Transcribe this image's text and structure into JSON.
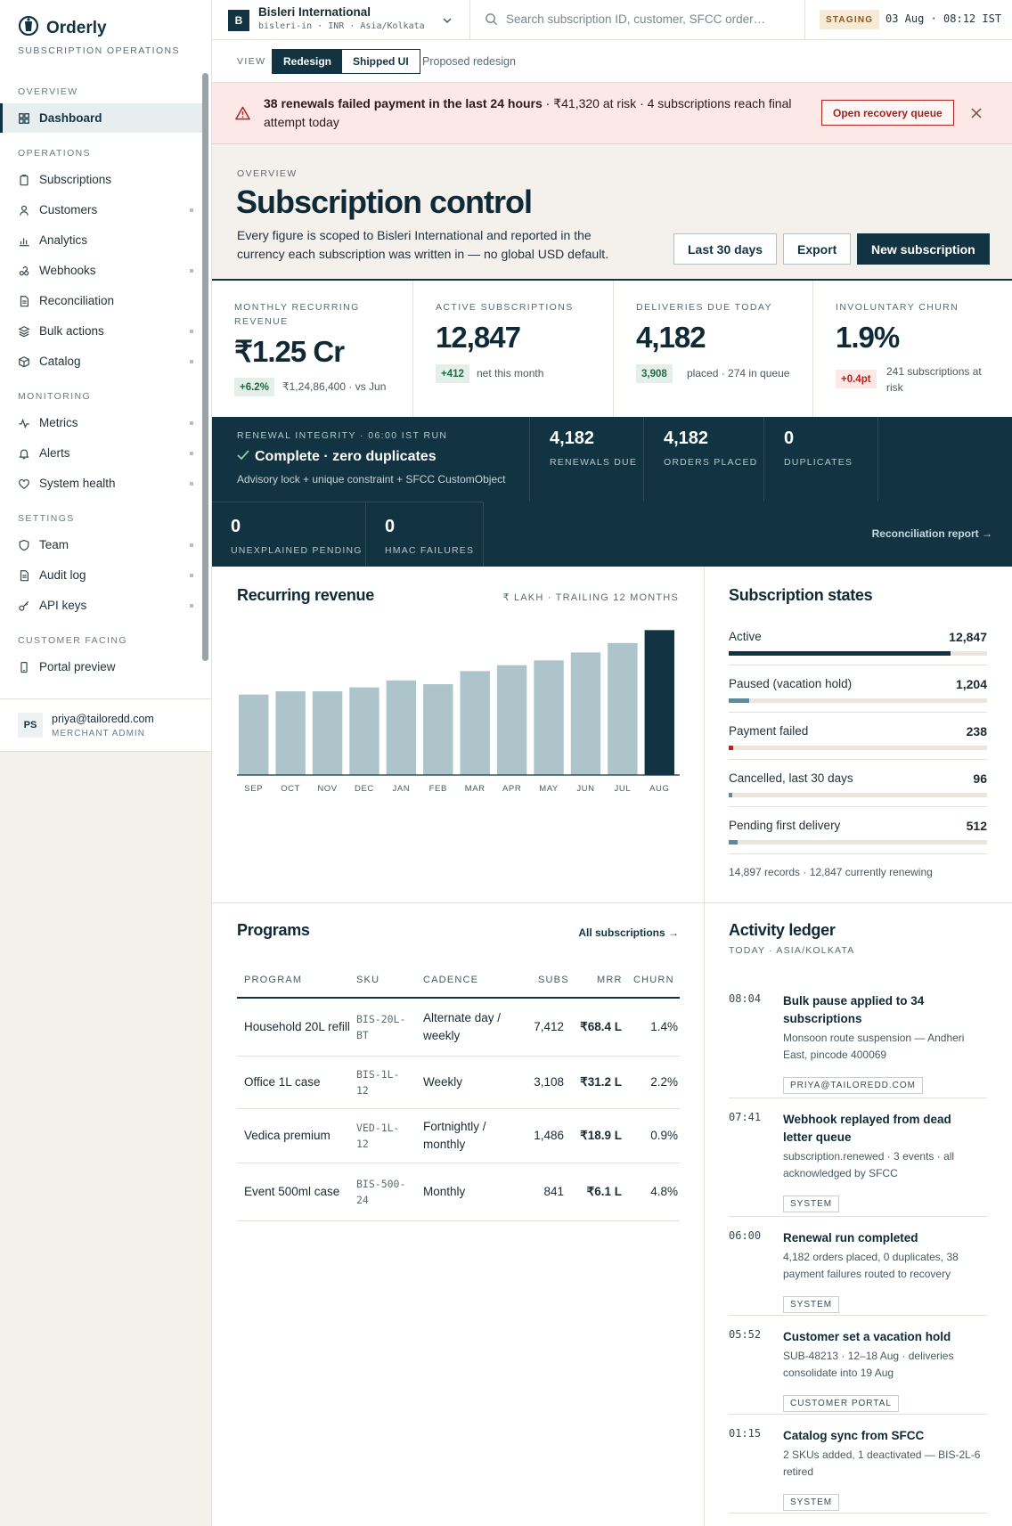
{
  "app": {
    "name": "Orderly",
    "subtitle": "SUBSCRIPTION OPERATIONS"
  },
  "sidebar": {
    "sections": [
      {
        "label": "OVERVIEW",
        "items": [
          {
            "label": "Dashboard",
            "icon": "grid-icon",
            "active": true
          }
        ]
      },
      {
        "label": "OPERATIONS",
        "items": [
          {
            "label": "Subscriptions",
            "icon": "clipboard-icon"
          },
          {
            "label": "Customers",
            "icon": "user-icon",
            "more": true
          },
          {
            "label": "Analytics",
            "icon": "bar-chart-icon"
          },
          {
            "label": "Webhooks",
            "icon": "webhook-icon",
            "more": true
          },
          {
            "label": "Reconciliation",
            "icon": "document-icon"
          },
          {
            "label": "Bulk actions",
            "icon": "layers-icon",
            "more": true
          },
          {
            "label": "Catalog",
            "icon": "box-icon",
            "more": true
          }
        ]
      },
      {
        "label": "MONITORING",
        "items": [
          {
            "label": "Metrics",
            "icon": "pulse-icon",
            "more": true
          },
          {
            "label": "Alerts",
            "icon": "bell-icon",
            "more": true
          },
          {
            "label": "System health",
            "icon": "heart-icon",
            "more": true
          }
        ]
      },
      {
        "label": "SETTINGS",
        "items": [
          {
            "label": "Team",
            "icon": "shield-icon",
            "more": true
          },
          {
            "label": "Audit log",
            "icon": "document-icon",
            "more": true
          },
          {
            "label": "API keys",
            "icon": "key-icon",
            "more": true
          }
        ]
      },
      {
        "label": "CUSTOMER FACING",
        "items": [
          {
            "label": "Portal preview",
            "icon": "phone-icon"
          }
        ]
      }
    ],
    "user": {
      "initials": "PS",
      "email": "priya@tailoredd.com",
      "role": "MERCHANT ADMIN"
    }
  },
  "topbar": {
    "org_initial": "B",
    "org_name": "Bisleri International",
    "org_meta": "bisleri-in · INR · Asia/Kolkata",
    "search_placeholder": "Search subscription ID, customer, SFCC order…",
    "env": "STAGING",
    "clock": "03 Aug · 08:12 IST"
  },
  "viewbar": {
    "label": "VIEW",
    "option_on": "Redesign",
    "option_off": "Shipped UI",
    "note": "Proposed redesign"
  },
  "alert": {
    "title": "38 renewals failed payment in the last 24 hours",
    "body": " · ₹41,320 at risk · 4 subscriptions reach final attempt today",
    "action": "Open recovery queue"
  },
  "hero": {
    "eyebrow": "OVERVIEW",
    "title": "Subscription control",
    "description": "Every figure is scoped to Bisleri International and reported in the currency each subscription was written in — no global USD default.",
    "btn_range": "Last 30 days",
    "btn_export": "Export",
    "btn_new": "New subscription"
  },
  "kpis": [
    {
      "label": "MONTHLY RECURRING REVENUE",
      "value": "₹1.25 Cr",
      "delta": "+6.2%",
      "delta_kind": "g",
      "note": "₹1,24,86,400 · vs Jun"
    },
    {
      "label": "ACTIVE SUBSCRIPTIONS",
      "value": "12,847",
      "delta": "+412",
      "delta_kind": "g",
      "note": "net this month"
    },
    {
      "label": "DELIVERIES DUE TODAY",
      "value": "4,182",
      "delta": "3,908",
      "delta_kind": "g",
      "note": "placed · 274 in queue"
    },
    {
      "label": "INVOLUNTARY CHURN",
      "value": "1.9%",
      "delta": "+0.4pt",
      "delta_kind": "r",
      "note": "241 subscriptions at risk"
    }
  ],
  "integrity": {
    "eyebrow": "RENEWAL INTEGRITY · 06:00 IST RUN",
    "title": "Complete · zero duplicates",
    "subtitle": "Advisory lock + unique constraint + SFCC CustomObject",
    "metrics": [
      {
        "value": "4,182",
        "label": "RENEWALS DUE"
      },
      {
        "value": "4,182",
        "label": "ORDERS PLACED"
      },
      {
        "value": "0",
        "label": "DUPLICATES"
      },
      {
        "value": "0",
        "label": "UNEXPLAINED PENDING"
      },
      {
        "value": "0",
        "label": "HMAC FAILURES"
      }
    ],
    "link": "Reconciliation report →"
  },
  "revenue": {
    "title": "Recurring revenue",
    "meta": "₹ LAKH · TRAILING 12 MONTHS"
  },
  "chart_data": {
    "type": "bar",
    "title": "Recurring revenue",
    "subtitle": "₹ LAKH · TRAILING 12 MONTHS",
    "categories": [
      "SEP",
      "OCT",
      "NOV",
      "DEC",
      "JAN",
      "FEB",
      "MAR",
      "APR",
      "MAY",
      "JUN",
      "JUL",
      "AUG"
    ],
    "values": [
      92.7,
      96.4,
      96.4,
      100.9,
      109.0,
      104.6,
      119.7,
      126.5,
      132.0,
      141.2,
      152.0,
      166.9
    ],
    "highlight_index": 11,
    "bar_color": "#adc4ca",
    "highlight_color": "#123442",
    "grid": false
  },
  "states": {
    "title": "Subscription states",
    "rows": [
      {
        "name": "Active",
        "value": "12,847",
        "fraction": 0.86,
        "color": "#123442"
      },
      {
        "name": "Paused (vacation hold)",
        "value": "1,204",
        "fraction": 0.08,
        "color": "#5e8a98"
      },
      {
        "name": "Payment failed",
        "value": "238",
        "fraction": 0.016,
        "color": "#b3261e"
      },
      {
        "name": "Cancelled, last 30 days",
        "value": "96",
        "fraction": 0.006,
        "color": "#5e8a98"
      },
      {
        "name": "Pending first delivery",
        "value": "512",
        "fraction": 0.034,
        "color": "#5e8a98"
      }
    ],
    "footer": "14,897 records · 12,847 currently renewing"
  },
  "programs": {
    "title": "Programs",
    "link": "All subscriptions →",
    "headers": [
      "PROGRAM",
      "SKU",
      "CADENCE",
      "SUBS",
      "MRR",
      "CHURN"
    ],
    "rows": [
      {
        "program": "Household 20L refill",
        "sku": "BIS-20L-BT",
        "cadence": "Alternate day / weekly",
        "subs": "7,412",
        "mrr": "₹68.4 L",
        "churn": "1.4%"
      },
      {
        "program": "Office 1L case",
        "sku": "BIS-1L-12",
        "cadence": "Weekly",
        "subs": "3,108",
        "mrr": "₹31.2 L",
        "churn": "2.2%"
      },
      {
        "program": "Vedica premium",
        "sku": "VED-1L-12",
        "cadence": "Fortnightly / monthly",
        "subs": "1,486",
        "mrr": "₹18.9 L",
        "churn": "0.9%"
      },
      {
        "program": "Event 500ml case",
        "sku": "BIS-500-24",
        "cadence": "Monthly",
        "subs": "841",
        "mrr": "₹6.1 L",
        "churn": "4.8%"
      }
    ]
  },
  "ledger": {
    "title": "Activity ledger",
    "subtitle": "TODAY · ASIA/KOLKATA",
    "events": [
      {
        "time": "08:04",
        "title": "Bulk pause applied to 34 subscriptions",
        "desc": "Monsoon route suspension — Andheri East, pincode 400069",
        "tag": "PRIYA@TAILOREDD.COM"
      },
      {
        "time": "07:41",
        "title": "Webhook replayed from dead letter queue",
        "desc": "subscription.renewed · 3 events · all acknowledged by SFCC",
        "tag": "SYSTEM"
      },
      {
        "time": "06:00",
        "title": "Renewal run completed",
        "desc": "4,182 orders placed, 0 duplicates, 38 payment failures routed to recovery",
        "tag": "SYSTEM"
      },
      {
        "time": "05:52",
        "title": "Customer set a vacation hold",
        "desc": "SUB-48213 · 12–18 Aug · deliveries consolidate into 19 Aug",
        "tag": "CUSTOMER PORTAL"
      },
      {
        "time": "01:15",
        "title": "Catalog sync from SFCC",
        "desc": "2 SKUs added, 1 deactivated — BIS-2L-6 retired",
        "tag": "SYSTEM"
      }
    ]
  }
}
